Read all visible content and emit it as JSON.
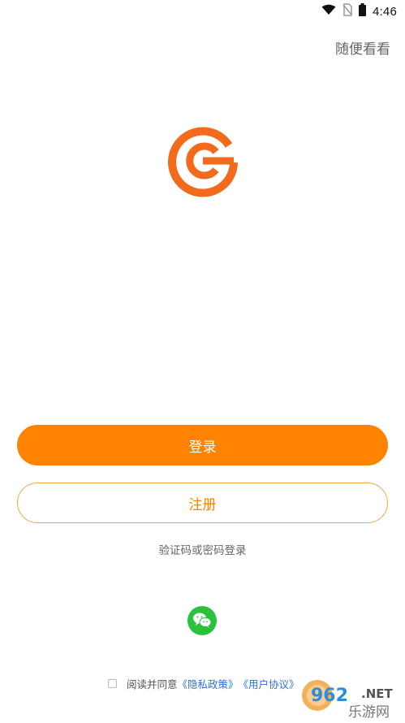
{
  "status_bar": {
    "time": "4:46",
    "icons": [
      "wifi-icon",
      "no-sim-icon",
      "battery-icon"
    ]
  },
  "header": {
    "skip_label": "随便看看"
  },
  "logo": {
    "name": "app-logo",
    "color": "#f26a1b"
  },
  "actions": {
    "login_label": "登录",
    "register_label": "注册",
    "alt_login_label": "验证码或密码登录"
  },
  "social": {
    "wechat_icon": "wechat-icon",
    "color": "#2ac13b"
  },
  "agreement": {
    "prefix": "阅读并同意",
    "privacy_link": "《隐私政策》",
    "terms_link": "《用户协议》"
  },
  "watermark": {
    "number": "962",
    "suffix": ".NET",
    "sub": "乐游网"
  },
  "colors": {
    "accent": "#ff8200",
    "link": "#2f6fd6",
    "text_secondary": "#666666"
  }
}
